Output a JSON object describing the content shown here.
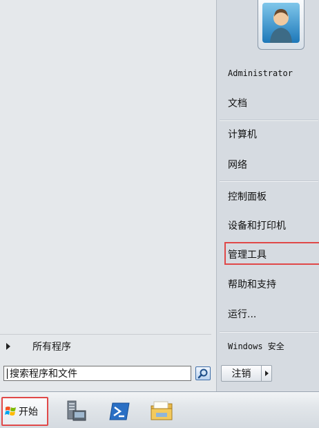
{
  "left_pane": {
    "all_programs_label": "所有程序",
    "search": {
      "value": "搜索程序和文件"
    }
  },
  "right_pane": {
    "items": [
      {
        "label": "Administrator"
      },
      {
        "label": "文档"
      },
      {
        "label": "计算机"
      },
      {
        "label": "网络"
      },
      {
        "label": "控制面板"
      },
      {
        "label": "设备和打印机"
      },
      {
        "label": "管理工具"
      },
      {
        "label": "帮助和支持"
      },
      {
        "label": "运行..."
      },
      {
        "label": "Windows 安全"
      }
    ],
    "logout_label": "注销"
  },
  "taskbar": {
    "start_label": "开始",
    "pinned_icons": [
      "server-manager-icon",
      "powershell-icon",
      "explorer-icon"
    ]
  },
  "colors": {
    "highlight": "#e04848",
    "left_pane_bg": "#e5e8eb",
    "right_pane_bg": "#d6dbe1"
  }
}
